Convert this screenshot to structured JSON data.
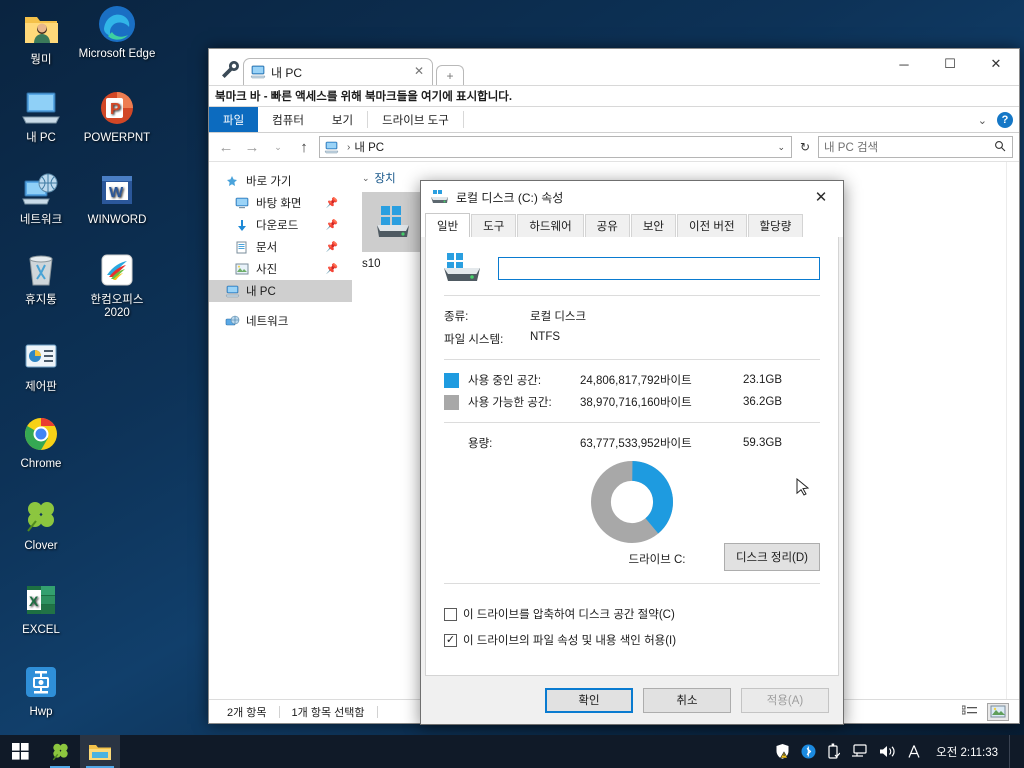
{
  "desktop": {
    "icons": [
      {
        "name": "뭥미",
        "icon": "folder-user-icon"
      },
      {
        "name": "Microsoft Edge",
        "icon": "edge-icon"
      },
      {
        "name": "내 PC",
        "icon": "this-pc-icon"
      },
      {
        "name": "POWERPNT",
        "icon": "powerpoint-icon"
      },
      {
        "name": "네트워크",
        "icon": "network-icon"
      },
      {
        "name": "WINWORD",
        "icon": "word-icon"
      },
      {
        "name": "휴지통",
        "icon": "recycle-bin-icon"
      },
      {
        "name": "한컴오피스 2020",
        "icon": "hancom-office-icon"
      },
      {
        "name": "제어판",
        "icon": "control-panel-icon"
      },
      {
        "name": "Chrome",
        "icon": "chrome-icon"
      },
      {
        "name": "Clover",
        "icon": "clover-icon"
      },
      {
        "name": "EXCEL",
        "icon": "excel-icon"
      },
      {
        "name": "Hwp",
        "icon": "hwp-icon"
      }
    ]
  },
  "explorer": {
    "tab": {
      "label": "내 PC",
      "close": "✕",
      "new_tab": "+"
    },
    "bookmark_bar": "북마크 바 - 빠른 액세스를 위해 북마크들을 여기에 표시합니다.",
    "window_controls": {
      "minimize": "─",
      "maximize": "☐",
      "close": "✕"
    },
    "ribbon_tabs": [
      {
        "label": "파일",
        "active": true
      },
      {
        "label": "컴퓨터",
        "active": false
      },
      {
        "label": "보기",
        "active": false
      },
      {
        "label": "드라이브 도구",
        "active": false
      }
    ],
    "ribbon_help": "?",
    "address": {
      "root": "내 PC",
      "separator": "›",
      "caret": "⌄",
      "refresh": "↻"
    },
    "search": {
      "placeholder": "내 PC 검색",
      "icon": "search-icon"
    },
    "nav_items": [
      {
        "label": "바로 가기",
        "icon": "quick-access-icon",
        "indent": false,
        "pinned": false,
        "selected": false
      },
      {
        "label": "바탕 화면",
        "icon": "desktop-icon",
        "indent": true,
        "pinned": true,
        "selected": false
      },
      {
        "label": "다운로드",
        "icon": "downloads-icon",
        "indent": true,
        "pinned": true,
        "selected": false
      },
      {
        "label": "문서",
        "icon": "documents-icon",
        "indent": true,
        "pinned": true,
        "selected": false
      },
      {
        "label": "사진",
        "icon": "pictures-icon",
        "indent": true,
        "pinned": true,
        "selected": false
      },
      {
        "label": "내 PC",
        "icon": "this-pc-icon",
        "indent": false,
        "pinned": false,
        "selected": true
      },
      {
        "label": "네트워크",
        "icon": "network-icon",
        "indent": false,
        "pinned": false,
        "selected": false
      }
    ],
    "content": {
      "group_header": "장치",
      "group_chevron": "⌄",
      "drive_tile_label": "s10",
      "tile_icon": "local-disk-icon"
    },
    "status": {
      "items": "2개 항목",
      "selected": "1개 항목 선택함"
    },
    "view_buttons": [
      {
        "name": "details-view",
        "active": false
      },
      {
        "name": "large-icons-view",
        "active": true
      }
    ]
  },
  "dialog": {
    "title": "로컬 디스크 (C:) 속성",
    "title_icon": "disk-icon",
    "close": "✕",
    "tabs": [
      {
        "label": "일반",
        "active": true
      },
      {
        "label": "도구",
        "active": false
      },
      {
        "label": "하드웨어",
        "active": false
      },
      {
        "label": "공유",
        "active": false
      },
      {
        "label": "보안",
        "active": false
      },
      {
        "label": "이전 버전",
        "active": false
      },
      {
        "label": "할당량",
        "active": false
      }
    ],
    "volume_name_value": "",
    "volume_name_placeholder": "",
    "info": [
      {
        "label": "종류:",
        "value": "로컬 디스크"
      },
      {
        "label": "파일 시스템:",
        "value": "NTFS"
      }
    ],
    "usage": [
      {
        "label": "사용 중인 공간:",
        "bytes": "24,806,817,792바이트",
        "gb": "23.1GB",
        "color": "#1e9be0"
      },
      {
        "label": "사용 가능한 공간:",
        "bytes": "38,970,716,160바이트",
        "gb": "36.2GB",
        "color": "#a8a8a8"
      }
    ],
    "capacity": {
      "label": "용량:",
      "bytes": "63,777,533,952바이트",
      "gb": "59.3GB"
    },
    "drive_caption": "드라이브 C:",
    "cleanup_button": "디스크 정리(D)",
    "checkboxes": [
      {
        "label": "이 드라이브를 압축하여 디스크 공간 절약(C)",
        "checked": false
      },
      {
        "label": "이 드라이브의 파일 속성 및 내용 색인 허용(I)",
        "checked": true
      }
    ],
    "buttons": [
      {
        "label": "확인",
        "style": "primary"
      },
      {
        "label": "취소",
        "style": "normal"
      },
      {
        "label": "적용(A)",
        "style": "disabled"
      }
    ]
  },
  "chart_data": {
    "type": "pie",
    "title": "드라이브 C: 디스크 사용량",
    "labels": [
      "사용 중인 공간",
      "사용 가능한 공간"
    ],
    "values": [
      23.1,
      36.2
    ],
    "units": "GB",
    "bytes": [
      24806817792,
      38970716160
    ],
    "total_bytes": 63777533952,
    "total_gb": 59.3,
    "colors": [
      "#1e9be0",
      "#a8a8a8"
    ],
    "used_percent": 38.9,
    "free_percent": 61.1,
    "donut": true,
    "legend_position": "left-list"
  },
  "taskbar": {
    "start": "start-icon",
    "pinned": [
      {
        "name": "clover-taskbar-icon",
        "state": "running"
      },
      {
        "name": "file-explorer-taskbar-icon",
        "state": "active"
      }
    ],
    "tray": [
      {
        "name": "security-shield-warning-icon",
        "glyph": "🛡"
      },
      {
        "name": "bluetooth-icon",
        "glyph": "✚"
      },
      {
        "name": "usb-safely-remove-icon",
        "glyph": "⎙"
      },
      {
        "name": "network-icon",
        "glyph": "🖳"
      },
      {
        "name": "volume-icon",
        "glyph": "🔊"
      },
      {
        "name": "ime-language-icon",
        "glyph": "A"
      }
    ],
    "clock": "오전 2:11:33"
  }
}
